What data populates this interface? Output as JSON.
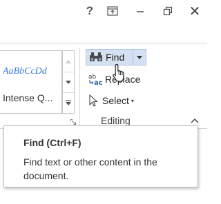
{
  "titlebar": {
    "help_label": "?",
    "close_label": "✕",
    "icons": [
      "help",
      "ribbon-display-options-icon",
      "minimize-icon",
      "restore-icon",
      "close-icon"
    ]
  },
  "styles": {
    "sample_text": "AaBbCcDd",
    "style_name": "Intense Q...",
    "sample_color": "#3a7bd5"
  },
  "editing": {
    "find_label": "Find",
    "replace_label": "Replace",
    "select_label": "Select",
    "group_label": "Editing"
  },
  "tooltip": {
    "title": "Find (Ctrl+F)",
    "body": "Find text or other content in the document."
  },
  "colors": {
    "find_highlight": "#d5e1f2",
    "find_border": "#a8c2e0"
  }
}
